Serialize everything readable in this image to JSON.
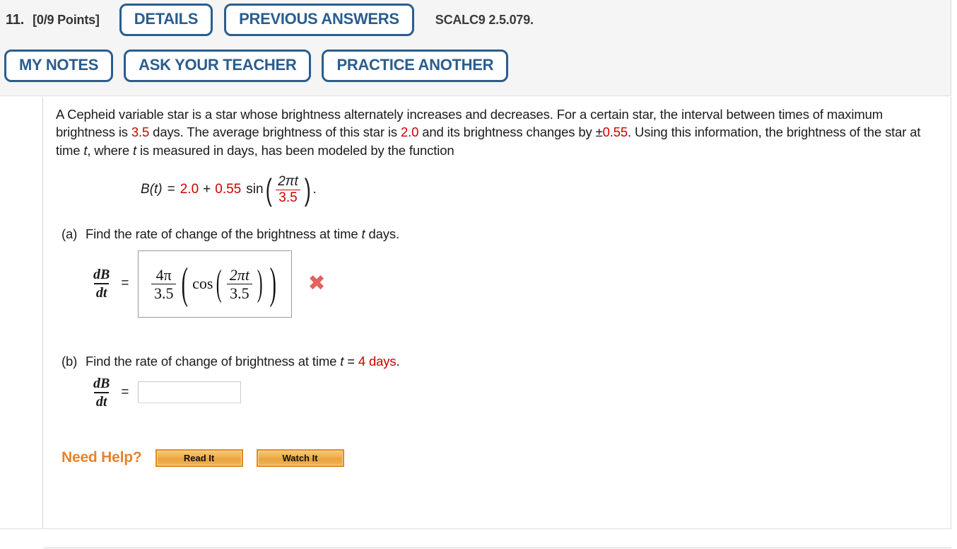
{
  "header": {
    "question_number": "11.",
    "points": "[0/9 Points]",
    "textbook_ref": "SCALC9 2.5.079.",
    "buttons": {
      "details": "DETAILS",
      "previous_answers": "PREVIOUS ANSWERS",
      "my_notes": "MY NOTES",
      "ask_your_teacher": "ASK YOUR TEACHER",
      "practice_another": "PRACTICE ANOTHER"
    },
    "accent_color": "#2a5d8f",
    "background_color": "#f5f5f5"
  },
  "problem": {
    "text_1": "A Cepheid variable star is a star whose brightness alternately increases and decreases. For a certain star, the interval between times of maximum brightness is ",
    "value_period": "3.5",
    "text_2": " days. The average brightness of this star is ",
    "value_average": "2.0",
    "text_3": " and its brightness changes by ±",
    "value_amplitude": "0.55",
    "text_4": ". Using this information, the brightness of the star at time ",
    "var_t_1": "t",
    "text_5": ", where ",
    "var_t_2": "t",
    "text_6": " is measured in days, has been modeled by the function",
    "highlight_color": "#cc0000"
  },
  "equation": {
    "lhs": "B",
    "lhs_arg": "(t)",
    "eq": "=",
    "const": "2.0",
    "plus": "+",
    "coef": "0.55",
    "fn": "sin",
    "numerator": "2πt",
    "denominator": "3.5",
    "period": "."
  },
  "parts": [
    {
      "label": "(a)",
      "question_pre": "Find the rate of change of the brightness at time ",
      "question_var": "t",
      "question_post": " days.",
      "answer_label_num": "dB",
      "answer_label_den": "dt",
      "equals": "=",
      "answer": {
        "coef_num": "4π",
        "coef_den": "3.5",
        "fn": "cos",
        "inner_num": "2πt",
        "inner_den": "3.5"
      },
      "status_icon": "x-mark-incorrect-icon",
      "status_color": "#e2635e"
    },
    {
      "label": "(b)",
      "question_pre": "Find the rate of change of brightness at time ",
      "question_var": "t",
      "question_mid": " = ",
      "question_value": "4 days",
      "question_post": ".",
      "answer_label_num": "dB",
      "answer_label_den": "dt",
      "equals": "=",
      "input_value": "",
      "input_placeholder": ""
    }
  ],
  "need_help": {
    "label": "Need Help?",
    "read_it": "Read It",
    "watch_it": "Watch It",
    "label_color": "#e8832a"
  }
}
